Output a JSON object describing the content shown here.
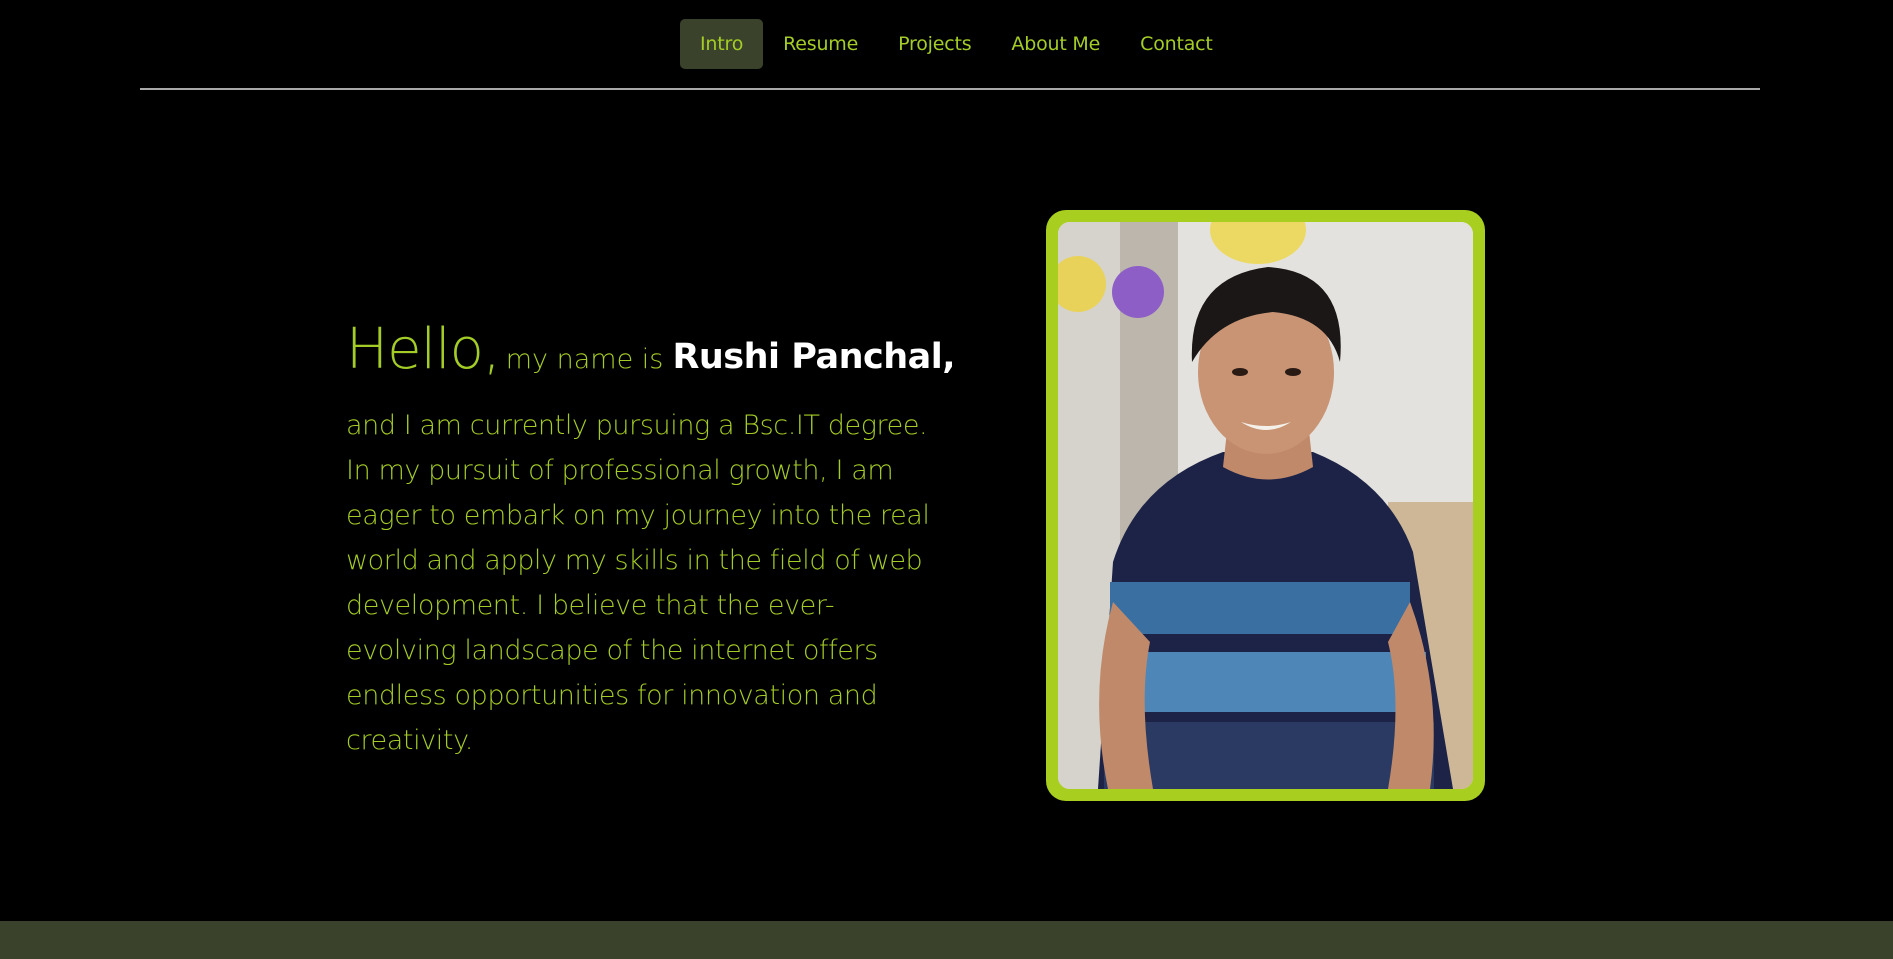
{
  "nav": {
    "items": [
      {
        "label": "Intro",
        "active": true
      },
      {
        "label": "Resume",
        "active": false
      },
      {
        "label": "Projects",
        "active": false
      },
      {
        "label": "About Me",
        "active": false
      },
      {
        "label": "Contact",
        "active": false
      }
    ]
  },
  "hero": {
    "hello": "Hello,",
    "my_name_is": "my name is",
    "name": "Rushi Panchal,",
    "bio": "and I am currently pursuing a Bsc.IT degree. In my pursuit of professional growth, I am eager to embark on my journey into the real world and apply my skills in the field of web development. I believe that the ever-evolving landscape of the internet offers endless opportunities for innovation and creativity."
  },
  "colors": {
    "accent": "#a4cc26",
    "frame": "#a8cf20",
    "nav_active_bg": "#3b422b",
    "footer_bg": "#3b422b",
    "background": "#000000"
  }
}
